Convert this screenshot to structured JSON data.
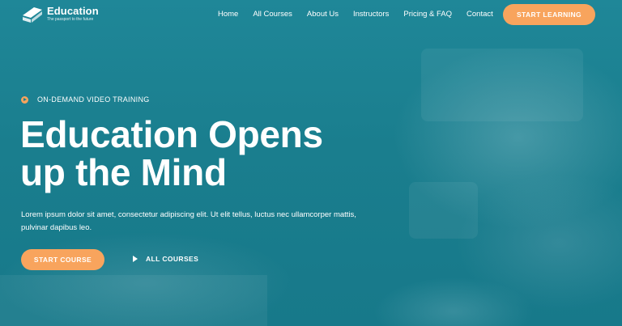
{
  "header": {
    "logo_title": "Education",
    "logo_tagline": "The passport to the future",
    "nav": [
      "Home",
      "All Courses",
      "About Us",
      "Instructors",
      "Pricing & FAQ",
      "Contact"
    ],
    "cta_label": "START LEARNING"
  },
  "hero": {
    "eyebrow": "ON-DEMAND VIDEO TRAINING",
    "headline_line1": "Education Opens",
    "headline_line2": "up the Mind",
    "description": "Lorem ipsum dolor sit amet, consectetur adipiscing elit. Ut elit tellus, luctus nec ullamcorper mattis, pulvinar dapibus leo.",
    "primary_button": "START COURSE",
    "secondary_button": "ALL COURSES"
  },
  "colors": {
    "accent": "#f8a45d",
    "overlay": "#1b7f8f",
    "text": "#ffffff"
  },
  "icons": {
    "logo": "graduation-book-icon",
    "eyebrow": "play-circle-icon",
    "secondary_button": "play-triangle-icon"
  }
}
